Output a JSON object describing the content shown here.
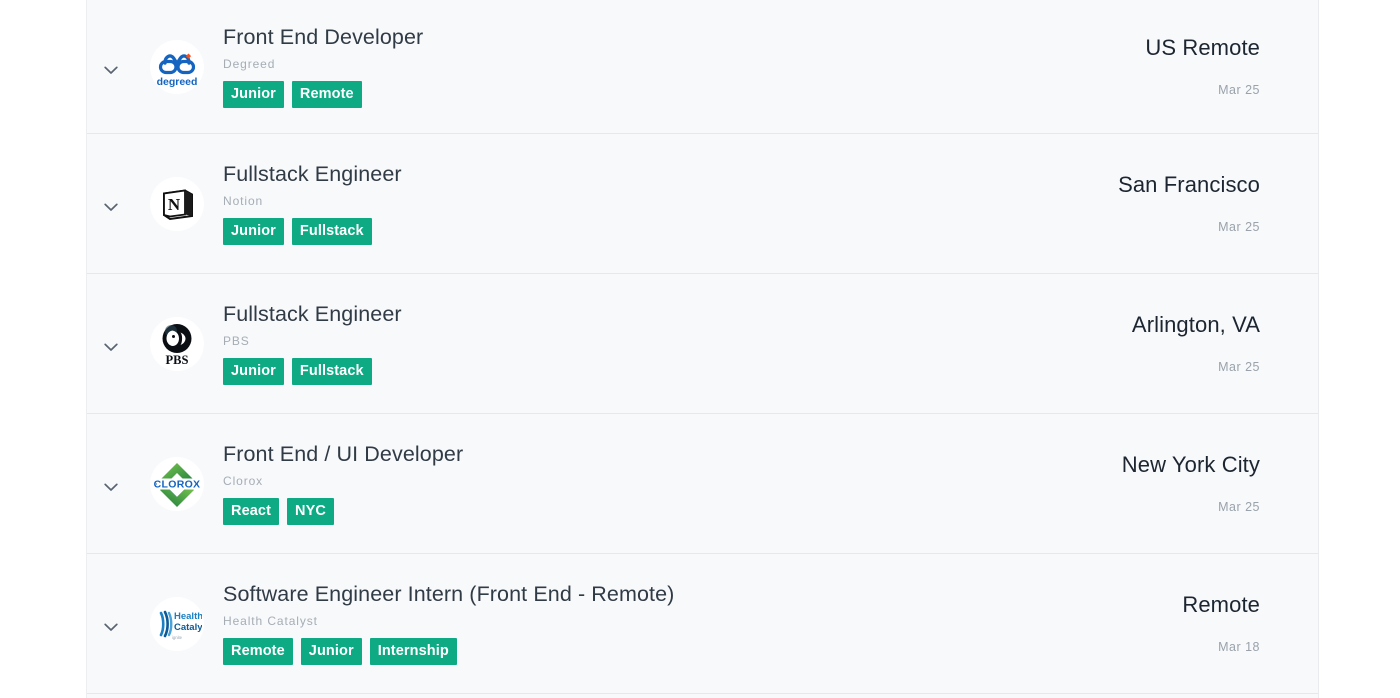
{
  "theme": {
    "tag_color": "#0eaa84",
    "panel_background": "#f7f9fb",
    "title_color": "#313b45",
    "company_color": "#a6adb5",
    "date_color": "#9aa2ab",
    "divider_color": "#e6e9ec"
  },
  "jobs": [
    {
      "title": "Front End Developer",
      "company": "Degreed",
      "logo": "degreed-logo",
      "tags": [
        "Junior",
        "Remote"
      ],
      "location": "US Remote",
      "date": "Mar 25",
      "expand_icon": "chevron-down-icon"
    },
    {
      "title": "Fullstack Engineer",
      "company": "Notion",
      "logo": "notion-logo",
      "tags": [
        "Junior",
        "Fullstack"
      ],
      "location": "San Francisco",
      "date": "Mar 25",
      "expand_icon": "chevron-down-icon"
    },
    {
      "title": "Fullstack Engineer",
      "company": "PBS",
      "logo": "pbs-logo",
      "tags": [
        "Junior",
        "Fullstack"
      ],
      "location": "Arlington, VA",
      "date": "Mar 25",
      "expand_icon": "chevron-down-icon"
    },
    {
      "title": "Front End / UI Developer",
      "company": "Clorox",
      "logo": "clorox-logo",
      "tags": [
        "React",
        "NYC"
      ],
      "location": "New York City",
      "date": "Mar 25",
      "expand_icon": "chevron-down-icon"
    },
    {
      "title": "Software Engineer Intern (Front End - Remote)",
      "company": "Health Catalyst",
      "logo": "health-catalyst-logo",
      "tags": [
        "Remote",
        "Junior",
        "Internship"
      ],
      "location": "Remote",
      "date": "Mar 18",
      "expand_icon": "chevron-down-icon"
    }
  ]
}
